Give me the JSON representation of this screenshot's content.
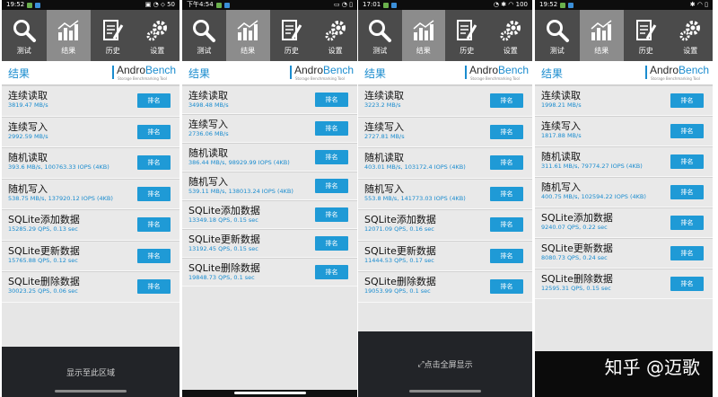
{
  "toolbar": {
    "test": "测试",
    "results": "结果",
    "history": "历史",
    "settings": "设置"
  },
  "header": {
    "title": "结果",
    "logo_main": "Andro",
    "logo_accent": "Bench",
    "logo_sub": "Storage Benchmarking Tool"
  },
  "rank_label": "排名",
  "accent_color": "#1a8ccf",
  "panels": [
    {
      "status_time": "19:52",
      "status_right": "▣ ◔ ⬦ 50",
      "rows": [
        {
          "name": "连续读取",
          "value": "3819.47 MB/s"
        },
        {
          "name": "连续写入",
          "value": "2992.59 MB/s"
        },
        {
          "name": "随机读取",
          "value": "393.6 MB/s, 100763.33 IOPS (4KB)"
        },
        {
          "name": "随机写入",
          "value": "538.75 MB/s, 137920.12 IOPS (4KB)"
        },
        {
          "name": "SQLite添加数据",
          "value": "15285.29 QPS, 0.13 sec"
        },
        {
          "name": "SQLite更新数据",
          "value": "15765.88 QPS, 0.12 sec"
        },
        {
          "name": "SQLite删除数据",
          "value": "30023.25 QPS, 0.06 sec"
        }
      ],
      "bottom_text": "显示至此区域"
    },
    {
      "status_time": "下午4:54",
      "status_right": "▭ ◔ ▯",
      "rows": [
        {
          "name": "连续读取",
          "value": "3498.48 MB/s"
        },
        {
          "name": "连续写入",
          "value": "2736.06 MB/s"
        },
        {
          "name": "随机读取",
          "value": "386.44 MB/s, 98929.99 IOPS (4KB)"
        },
        {
          "name": "随机写入",
          "value": "539.11 MB/s, 138013.24 IOPS (4KB)"
        },
        {
          "name": "SQLite添加数据",
          "value": "13349.18 QPS, 0.15 sec"
        },
        {
          "name": "SQLite更新数据",
          "value": "13192.45 QPS, 0.15 sec"
        },
        {
          "name": "SQLite删除数据",
          "value": "19848.73 QPS, 0.1 sec"
        }
      ]
    },
    {
      "status_time": "17:01",
      "status_right": "◔ ✱ ◠ 100",
      "rows": [
        {
          "name": "连续读取",
          "value": "3223.2 MB/s"
        },
        {
          "name": "连续写入",
          "value": "2727.81 MB/s"
        },
        {
          "name": "随机读取",
          "value": "403.01 MB/s, 103172.4 IOPS (4KB)"
        },
        {
          "name": "随机写入",
          "value": "553.8 MB/s, 141773.03 IOPS (4KB)"
        },
        {
          "name": "SQLite添加数据",
          "value": "12071.09 QPS, 0.16 sec"
        },
        {
          "name": "SQLite更新数据",
          "value": "11444.53 QPS, 0.17 sec"
        },
        {
          "name": "SQLite删除数据",
          "value": "19053.99 QPS, 0.1 sec"
        }
      ],
      "bottom_text": "点击全屏显示"
    },
    {
      "status_time": "19:52",
      "status_right": "✱ ◠ ▯",
      "rows": [
        {
          "name": "连续读取",
          "value": "1998.21 MB/s"
        },
        {
          "name": "连续写入",
          "value": "1817.88 MB/s"
        },
        {
          "name": "随机读取",
          "value": "311.61 MB/s, 79774.27 IOPS (4KB)"
        },
        {
          "name": "随机写入",
          "value": "400.75 MB/s, 102594.22 IOPS (4KB)"
        },
        {
          "name": "SQLite添加数据",
          "value": "9240.07 QPS, 0.22 sec"
        },
        {
          "name": "SQLite更新数据",
          "value": "8080.73 QPS, 0.24 sec"
        },
        {
          "name": "SQLite删除数据",
          "value": "12595.31 QPS, 0.15 sec"
        }
      ]
    }
  ],
  "watermark": "知乎 @迈歌"
}
